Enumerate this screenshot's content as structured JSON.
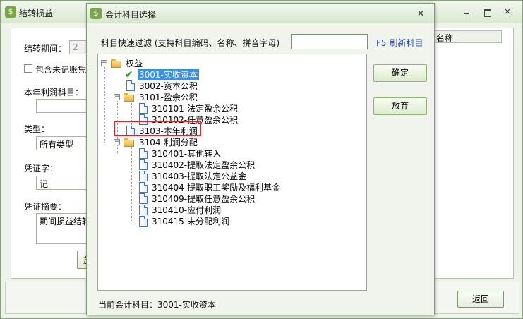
{
  "background_window": {
    "title": "结转损益",
    "period_label": "结转期间：",
    "period_value": "2",
    "include_unposted_label": "包含未记账凭证",
    "profit_account_label": "本年利润科目：",
    "profit_account_value": "",
    "type_label": "类型：",
    "type_value": "所有类型",
    "voucher_word_label": "凭证字：",
    "voucher_word_value": "记",
    "summary_label": "凭证摘要：",
    "summary_value": "期间损益结转",
    "grid_header_name": "名称",
    "partial_button": "放",
    "return_button": "返回"
  },
  "dialog": {
    "title": "会计科目选择",
    "filter_label": "科目快速过滤 (支持科目编码、名称、拼音字母)",
    "filter_value": "",
    "refresh_link": "F5 刷新科目",
    "ok_button": "确定",
    "cancel_button": "放弃",
    "current_account": "当前会计科目：3001-实收资本",
    "tree": {
      "root": "权益",
      "items": [
        {
          "label": "3001-实收资本",
          "selected": true,
          "checked": true
        },
        {
          "label": "3002-资本公积"
        },
        {
          "label": "3101-盈余公积",
          "expanded": true
        },
        {
          "label": "310101-法定盈余公积"
        },
        {
          "label": "310102-任意盈余公积"
        },
        {
          "label": "3103-本年利润",
          "highlighted": true
        },
        {
          "label": "3104-利润分配",
          "expanded": true
        },
        {
          "label": "310401-其他转入"
        },
        {
          "label": "310402-提取法定盈余公积"
        },
        {
          "label": "310403-提取法定公益金"
        },
        {
          "label": "310404-提取职工奖励及福利基金"
        },
        {
          "label": "310409-提取任意盈余公积"
        },
        {
          "label": "310410-应付利润"
        },
        {
          "label": "310415-未分配利润"
        }
      ]
    }
  },
  "colors": {
    "selection": "#3a8ee6",
    "highlight_box": "#e0232c",
    "link": "#1e3fa8"
  }
}
